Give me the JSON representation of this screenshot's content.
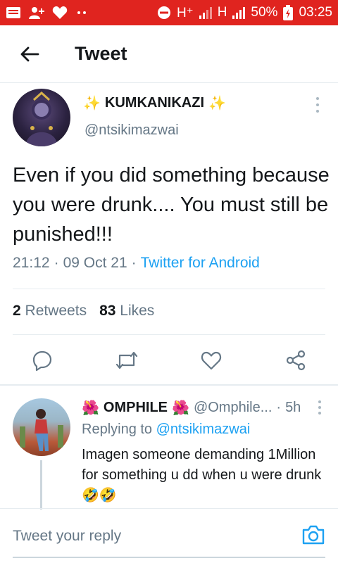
{
  "status_bar": {
    "network_1": "H⁺",
    "network_2": "H",
    "battery": "50%",
    "time": "03:25",
    "background_color": "#e0241f"
  },
  "app_bar": {
    "title": "Tweet"
  },
  "tweet": {
    "display_name": "KUMKANIKAZI",
    "sparkle_left": "✨",
    "sparkle_right": "✨",
    "handle": "@ntsikimazwai",
    "text": "Even if you did something because you were drunk.... You must still be punished!!!",
    "time": "21:12",
    "date": "09 Oct 21",
    "source": "Twitter for Android",
    "retweets_count": "2",
    "retweets_label": "Retweets",
    "likes_count": "83",
    "likes_label": "Likes",
    "link_color": "#1da1f2"
  },
  "reply": {
    "flower_left": "🌺",
    "display_name": "OMPHILE",
    "flower_right": "🌺",
    "handle": "@Omphile...",
    "time_ago": "5h",
    "replying_label": "Replying to",
    "replying_to": "@ntsikimazwai",
    "text": "Imagen someone demanding 1Million for something u dd when u were drunk🤣🤣"
  },
  "composer": {
    "placeholder": "Tweet your reply"
  }
}
